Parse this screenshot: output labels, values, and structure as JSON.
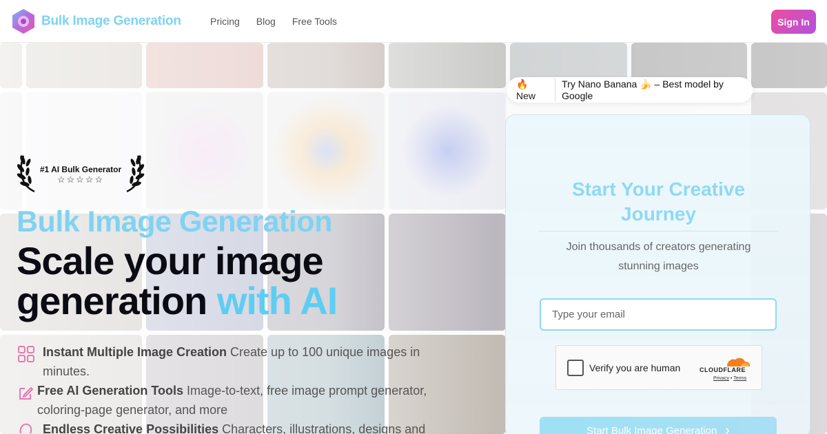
{
  "header": {
    "brand": "Bulk Image Generation",
    "nav": [
      "Pricing",
      "Blog",
      "Free Tools"
    ],
    "signin_label": "Sign In"
  },
  "award": {
    "title": "#1 AI Bulk Generator",
    "stars": "☆☆☆☆☆"
  },
  "hero": {
    "kicker": "Bulk Image Generation",
    "headline_line1": "Scale your image",
    "headline_line2": "generation",
    "headline_accent": "with AI"
  },
  "features": [
    {
      "title": "Instant Multiple Image Creation",
      "text": " Create up to 100 unique images in minutes."
    },
    {
      "title": "Free AI Generation Tools",
      "text": " Image-to-text, free image prompt generator, coloring-page generator, and more"
    },
    {
      "title": "Endless Creative Possibilities",
      "text": " Characters, illustrations, designs and"
    }
  ],
  "pill": {
    "badge": "🔥 New",
    "text": "Try Nano Banana 🍌 – Best model by Google"
  },
  "card": {
    "title_line1": "Start Your Creative",
    "title_line2": "Journey",
    "subtitle": "Join thousands of creators generating stunning images",
    "email_placeholder": "Type your email",
    "captcha_label": "Verify you are human",
    "cf_name": "CLOUDFLARE",
    "cf_privacy": "Privacy",
    "cf_sep": "•",
    "cf_terms": "Terms",
    "start_label": "Start Bulk Image Generation",
    "start_icon": "›"
  },
  "colors": {
    "brand": "#7fd3f2",
    "accent": "#5ecdf2",
    "signin_gradient_start": "#ee4e9c",
    "signin_gradient_end": "#b251e0"
  },
  "icons": {
    "logo": "gem-logo-icon",
    "feature1": "grid-icon",
    "feature2": "edit-icon",
    "feature3": "palette-icon"
  }
}
